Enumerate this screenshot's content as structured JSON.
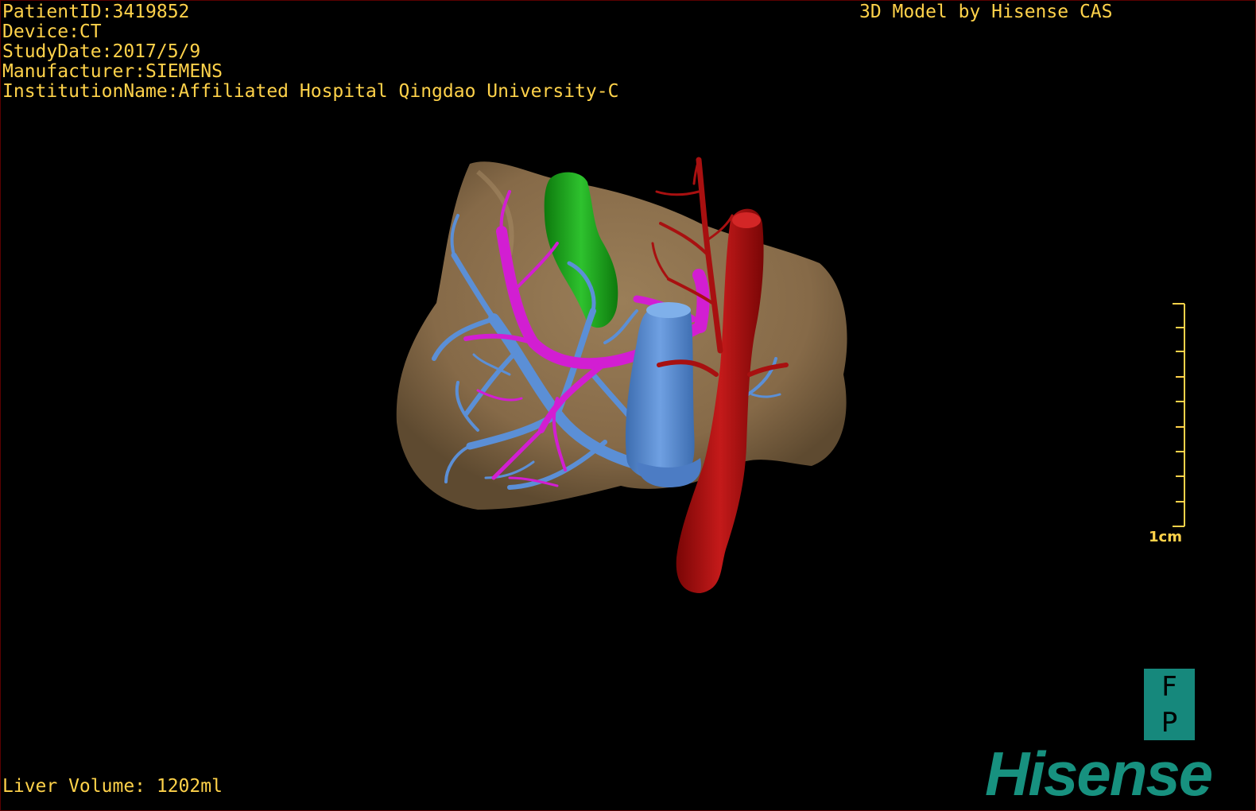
{
  "overlay": {
    "patient_id": "PatientID:3419852",
    "device": "Device:CT",
    "study_date": "StudyDate:2017/5/9",
    "manufacturer": "Manufacturer:SIEMENS",
    "institution": "InstitutionName:Affiliated Hospital Qingdao University-C",
    "credit": "3D Model by Hisense CAS",
    "liver_volume": "Liver Volume: 1202ml"
  },
  "scale": {
    "label": "1cm",
    "divisions": 10
  },
  "orientation": {
    "top": "F",
    "bottom": "P"
  },
  "brand": {
    "logo_text": "Hisense",
    "color": "#17917f"
  },
  "colors": {
    "background": "#000000",
    "overlay_text": "#ffd24a",
    "liver": "#8a7050",
    "gallbladder": "#1ea81e",
    "portal_vein": "#5b8fd6",
    "hepatic_vein": "#d21ed2",
    "artery": "#b01010"
  }
}
